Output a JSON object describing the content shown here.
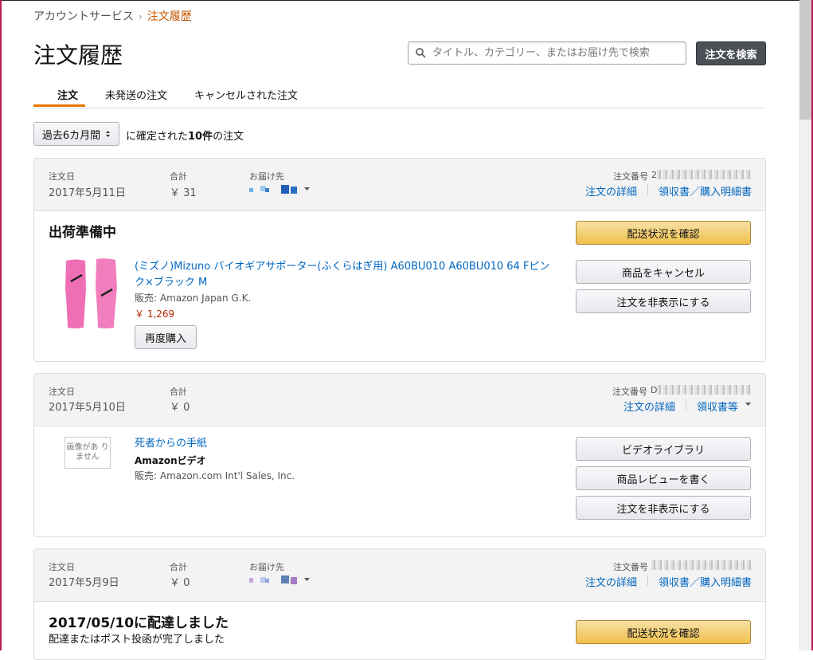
{
  "breadcrumb": {
    "parent": "アカウントサービス",
    "separator": "›",
    "current": "注文履歴"
  },
  "page_title": "注文履歴",
  "search": {
    "placeholder": "タイトル、カテゴリー、またはお届け先で検索",
    "button": "注文を検索"
  },
  "tabs": [
    {
      "label": "注文",
      "active": true
    },
    {
      "label": "未発送の注文",
      "active": false
    },
    {
      "label": "キャンセルされた注文",
      "active": false
    }
  ],
  "filter": {
    "selected": "過去6カ月間",
    "text_prefix": "に確定された",
    "count": "10件",
    "text_suffix": "の注文"
  },
  "labels": {
    "order_date": "注文日",
    "total": "合計",
    "ship_to": "お届け先",
    "order_number": "注文番号",
    "order_details": "注文の詳細",
    "receipt_full": "領収書／購入明細書",
    "receipt_short": "領収書等"
  },
  "orders": [
    {
      "date": "2017年5月11日",
      "total": "￥ 31",
      "order_number_prefix": "2",
      "status": "出荷準備中",
      "product_title": "(ミズノ)Mizuno バイオギアサポーター(ふくらはぎ用) A60BU010 A60BU010 64 Fピンク×ブラック M",
      "seller": "販売: Amazon Japan G.K.",
      "price": "￥ 1,269",
      "buy_again": "再度購入",
      "buttons": [
        "配送状況を確認",
        "商品をキャンセル",
        "注文を非表示にする"
      ]
    },
    {
      "date": "2017年5月10日",
      "total": "￥ 0",
      "order_number_prefix": "D",
      "no_image": "画像があ りません",
      "product_title": "死者からの手紙",
      "format": "Amazonビデオ",
      "seller": "販売: Amazon.com Int'l Sales, Inc.",
      "buttons": [
        "ビデオライブラリ",
        "商品レビューを書く",
        "注文を非表示にする"
      ]
    },
    {
      "date": "2017年5月9日",
      "total": "￥ 0",
      "status": "2017/05/10に配達しました",
      "status_sub": "配達またはポスト投函が完了しました",
      "buttons": [
        "配送状況を確認"
      ]
    }
  ],
  "colors": {
    "link": "#0066c0",
    "accent": "#e77600",
    "price": "#b12704",
    "primary_button": "#f0c14b"
  }
}
